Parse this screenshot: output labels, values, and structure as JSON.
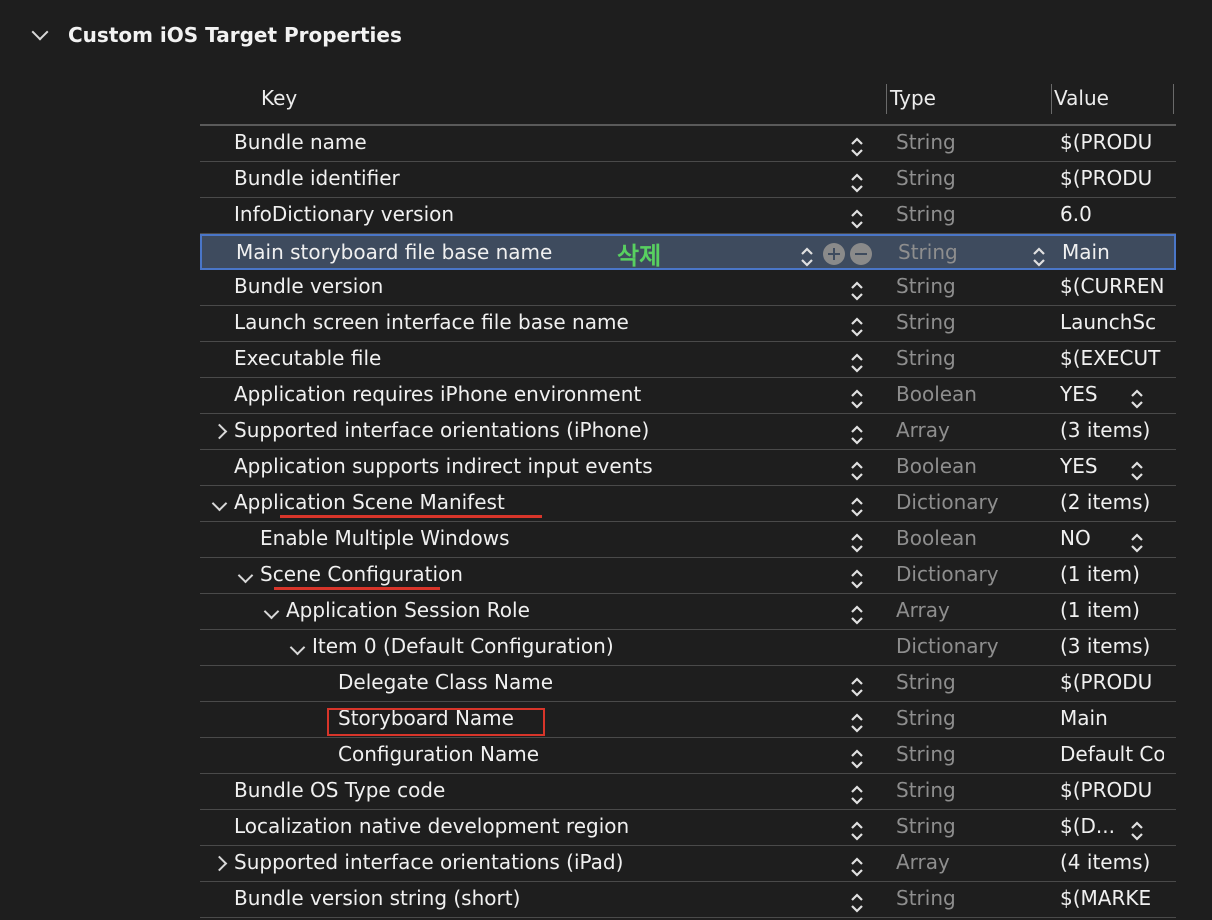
{
  "section": {
    "title": "Custom iOS Target Properties"
  },
  "columns": {
    "key": "Key",
    "type": "Type",
    "value": "Value"
  },
  "annotation": "삭제",
  "rows": [
    {
      "key": "Bundle name",
      "type": "String",
      "value": "$(PRODU",
      "indent": 0,
      "expander": "none",
      "stepper": true
    },
    {
      "key": "Bundle identifier",
      "type": "String",
      "value": "$(PRODU",
      "indent": 0,
      "expander": "none",
      "stepper": true
    },
    {
      "key": "InfoDictionary version",
      "type": "String",
      "value": "6.0",
      "indent": 0,
      "expander": "none",
      "stepper": true
    },
    {
      "key": "Main storyboard file base name",
      "type": "String",
      "value": "Main",
      "indent": 0,
      "expander": "none",
      "stepper": true,
      "selected": true
    },
    {
      "key": "Bundle version",
      "type": "String",
      "value": "$(CURREN",
      "indent": 0,
      "expander": "none",
      "stepper": true
    },
    {
      "key": "Launch screen interface file base name",
      "type": "String",
      "value": "LaunchSc",
      "indent": 0,
      "expander": "none",
      "stepper": true
    },
    {
      "key": "Executable file",
      "type": "String",
      "value": "$(EXECUT",
      "indent": 0,
      "expander": "none",
      "stepper": true
    },
    {
      "key": "Application requires iPhone environment",
      "type": "Boolean",
      "value": "YES",
      "indent": 0,
      "expander": "none",
      "stepper": true,
      "value_stepper": true
    },
    {
      "key": "Supported interface orientations (iPhone)",
      "type": "Array",
      "value": "(3 items)",
      "indent": 0,
      "expander": "right",
      "stepper": true
    },
    {
      "key": "Application supports indirect input events",
      "type": "Boolean",
      "value": "YES",
      "indent": 0,
      "expander": "none",
      "stepper": true,
      "value_stepper": true
    },
    {
      "key": "Application Scene Manifest",
      "type": "Dictionary",
      "value": "(2 items)",
      "indent": 0,
      "expander": "down",
      "stepper": true
    },
    {
      "key": "Enable Multiple Windows",
      "type": "Boolean",
      "value": "NO",
      "indent": 1,
      "expander": "none",
      "stepper": true,
      "value_stepper": true
    },
    {
      "key": "Scene Configuration",
      "type": "Dictionary",
      "value": "(1 item)",
      "indent": 1,
      "expander": "down",
      "stepper": true
    },
    {
      "key": "Application Session Role",
      "type": "Array",
      "value": "(1 item)",
      "indent": 2,
      "expander": "down",
      "stepper": true
    },
    {
      "key": "Item 0 (Default Configuration)",
      "type": "Dictionary",
      "value": "(3 items)",
      "indent": 3,
      "expander": "down",
      "stepper": false
    },
    {
      "key": "Delegate Class Name",
      "type": "String",
      "value": "$(PRODU",
      "indent": 4,
      "expander": "none",
      "stepper": true
    },
    {
      "key": "Storyboard Name",
      "type": "String",
      "value": "Main",
      "indent": 4,
      "expander": "none",
      "stepper": true
    },
    {
      "key": "Configuration Name",
      "type": "String",
      "value": "Default Co",
      "indent": 4,
      "expander": "none",
      "stepper": true
    },
    {
      "key": "Bundle OS Type code",
      "type": "String",
      "value": "$(PRODU",
      "indent": 0,
      "expander": "none",
      "stepper": true
    },
    {
      "key": "Localization native development region",
      "type": "String",
      "value": "$(D...",
      "indent": 0,
      "expander": "none",
      "stepper": true,
      "value_stepper": true
    },
    {
      "key": "Supported interface orientations (iPad)",
      "type": "Array",
      "value": "(4 items)",
      "indent": 0,
      "expander": "right",
      "stepper": true
    },
    {
      "key": "Bundle version string (short)",
      "type": "String",
      "value": "$(MARKE",
      "indent": 0,
      "expander": "none",
      "stepper": true
    }
  ]
}
